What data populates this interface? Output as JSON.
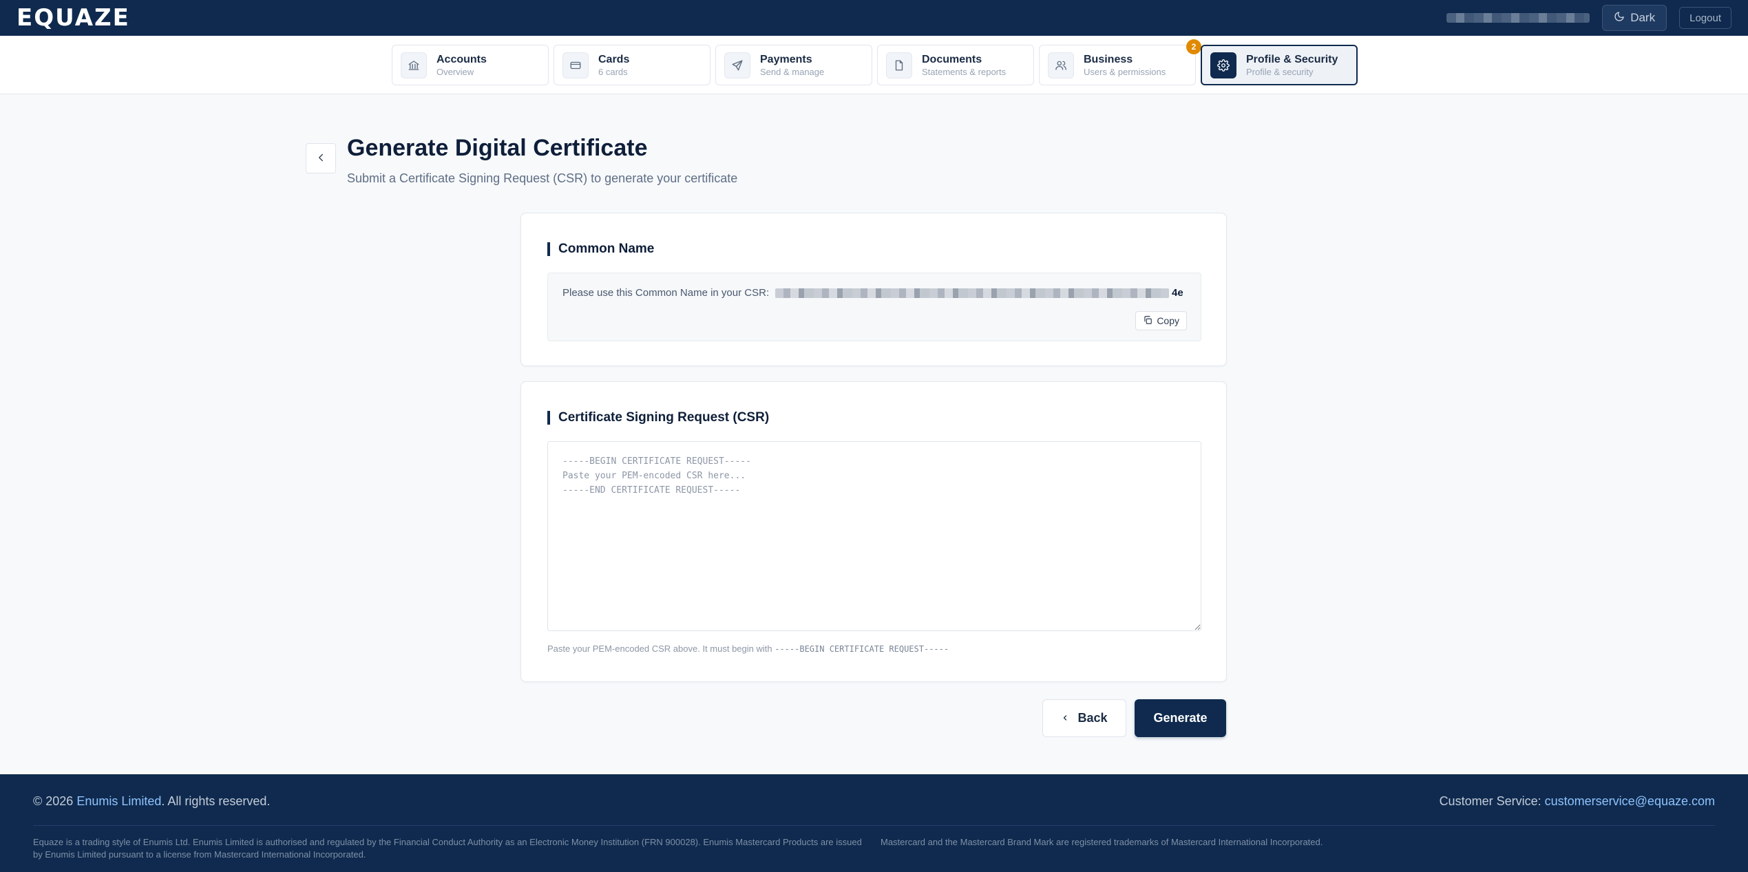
{
  "header": {
    "logo": "EQUAZE",
    "theme_label": "Dark",
    "logout_label": "Logout"
  },
  "nav": {
    "tabs": [
      {
        "label": "Accounts",
        "sub": "Overview",
        "icon": "bank-icon"
      },
      {
        "label": "Cards",
        "sub": "6 cards",
        "icon": "credit-card-icon"
      },
      {
        "label": "Payments",
        "sub": "Send & manage",
        "icon": "send-icon"
      },
      {
        "label": "Documents",
        "sub": "Statements & reports",
        "icon": "document-icon"
      },
      {
        "label": "Business",
        "sub": "Users & permissions",
        "icon": "users-icon",
        "badge": "2"
      },
      {
        "label": "Profile & Security",
        "sub": "Profile & security",
        "icon": "gear-icon",
        "active": true
      }
    ]
  },
  "page": {
    "title": "Generate Digital Certificate",
    "subtitle": "Submit a Certificate Signing Request (CSR) to generate your certificate"
  },
  "common_name": {
    "title": "Common Name",
    "label": "Please use this Common Name in your CSR:",
    "value_visible_suffix": "4e",
    "copy_label": "Copy"
  },
  "csr": {
    "title": "Certificate Signing Request (CSR)",
    "placeholder": "-----BEGIN CERTIFICATE REQUEST-----\nPaste your PEM-encoded CSR here...\n-----END CERTIFICATE REQUEST-----",
    "value": "",
    "help_prefix": "Paste your PEM-encoded CSR above. It must begin with",
    "help_code": "-----BEGIN CERTIFICATE REQUEST-----"
  },
  "actions": {
    "back_label": "Back",
    "generate_label": "Generate"
  },
  "footer": {
    "copyright_prefix": "© 2026",
    "company": "Enumis Limited",
    "copyright_suffix": ". All rights reserved.",
    "cs_label": "Customer Service:",
    "cs_email": "customerservice@equaze.com",
    "legal_left": "Equaze is a trading style of Enumis Ltd. Enumis Limited is authorised and regulated by the Financial Conduct Authority as an Electronic Money Institution (FRN 900028). Enumis Mastercard Products are issued by Enumis Limited pursuant to a license from Mastercard International Incorporated.",
    "legal_right": "Mastercard and the Mastercard Brand Mark are registered trademarks of Mastercard International Incorporated."
  },
  "colors": {
    "navy": "#0f2a4e",
    "page_bg": "#f7f9fb",
    "badge": "#e08a00",
    "link": "#8ec3ff"
  }
}
